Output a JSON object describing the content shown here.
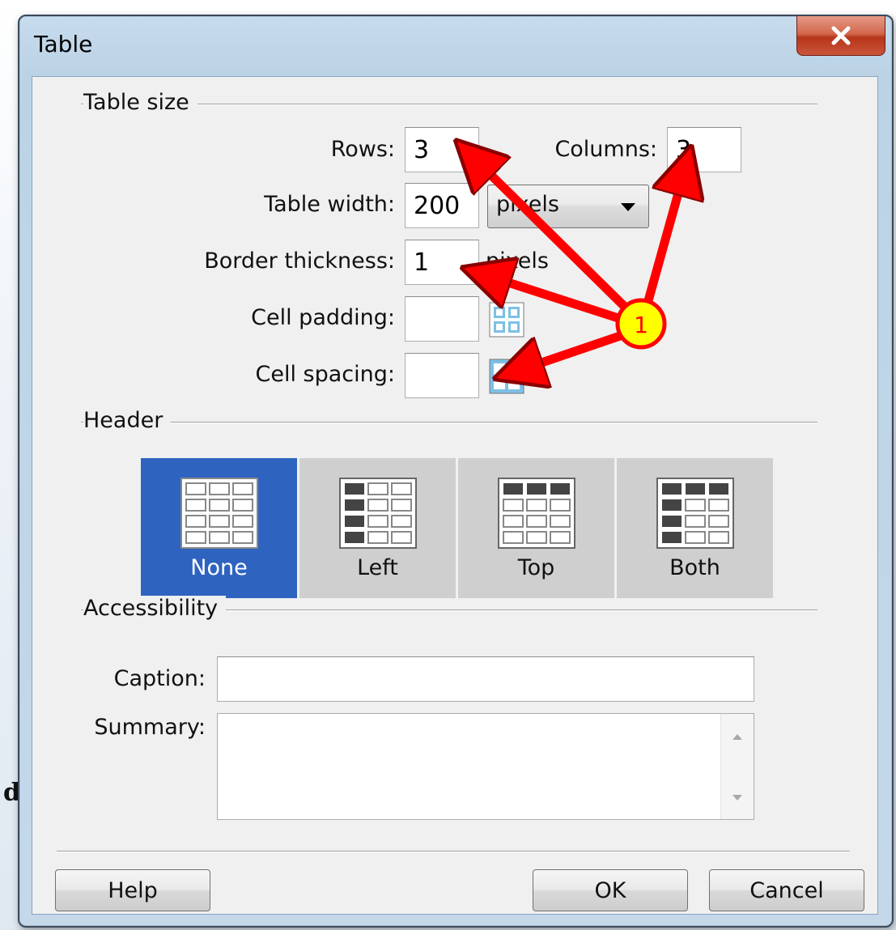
{
  "window": {
    "title": "Table"
  },
  "table_size": {
    "title": "Table size",
    "rows_label": "Rows:",
    "rows_value": "3",
    "columns_label": "Columns:",
    "columns_value": "3",
    "width_label": "Table width:",
    "width_value": "200",
    "width_unit": "pixels",
    "border_label": "Border thickness:",
    "border_value": "1",
    "border_unit": "pixels",
    "padding_label": "Cell padding:",
    "padding_value": "",
    "spacing_label": "Cell spacing:",
    "spacing_value": ""
  },
  "header": {
    "title": "Header",
    "options": [
      {
        "label": "None",
        "selected": true
      },
      {
        "label": "Left",
        "selected": false
      },
      {
        "label": "Top",
        "selected": false
      },
      {
        "label": "Both",
        "selected": false
      }
    ]
  },
  "accessibility": {
    "title": "Accessibility",
    "caption_label": "Caption:",
    "caption_value": "",
    "summary_label": "Summary:",
    "summary_value": ""
  },
  "buttons": {
    "help": "Help",
    "ok": "OK",
    "cancel": "Cancel"
  },
  "annotation": {
    "callout_number": "1",
    "arrow_color": "#ff0000",
    "callout_fill": "#ffff00"
  },
  "background_fragment": "d",
  "colors": {
    "selected_tile": "#2e63c0",
    "close_button": "#c9553b"
  }
}
